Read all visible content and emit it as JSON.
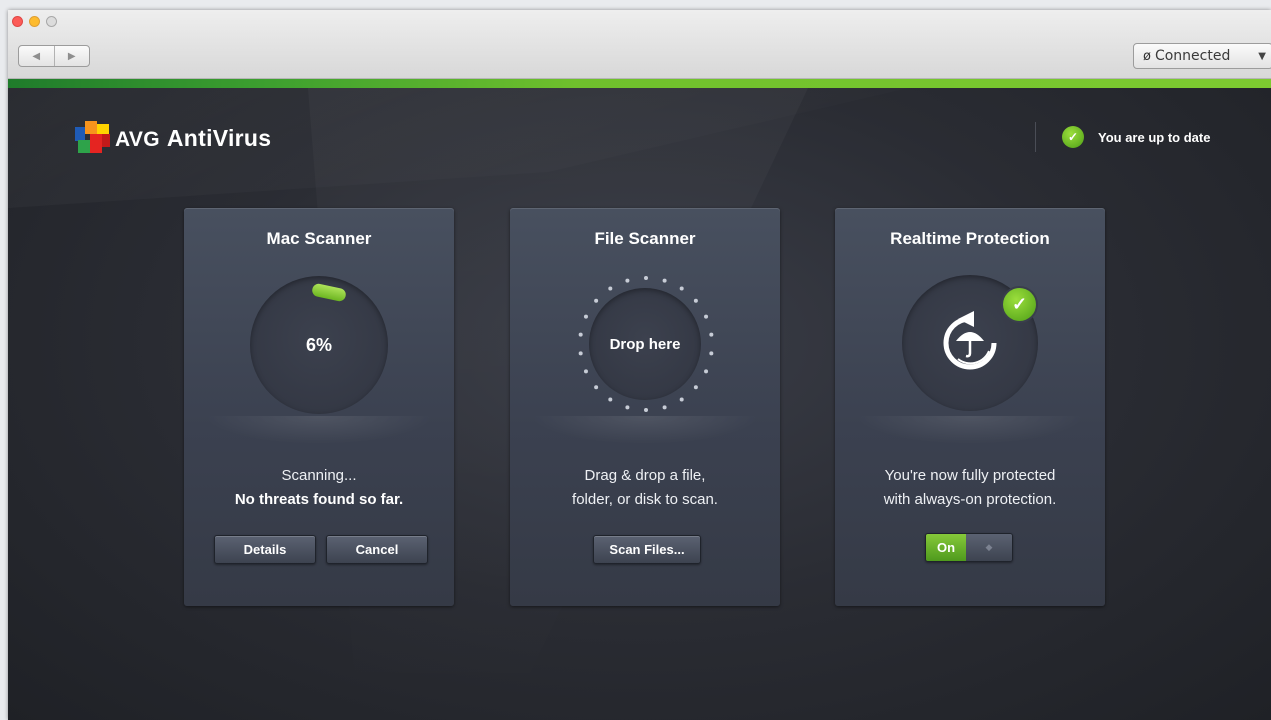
{
  "window": {
    "connection": {
      "label": "Connected"
    }
  },
  "header": {
    "logo": {
      "brand": "AVG",
      "product": "AntiVirus"
    },
    "status": {
      "text": "You are up to date"
    }
  },
  "cards": {
    "mac_scanner": {
      "title": "Mac Scanner",
      "progress": "6%",
      "progress_value": 0.06,
      "line1": "Scanning...",
      "line2": "No threats found so far.",
      "details_label": "Details",
      "cancel_label": "Cancel"
    },
    "file_scanner": {
      "title": "File Scanner",
      "drop_label": "Drop here",
      "line1": "Drag & drop a file,",
      "line2": "folder, or disk to scan.",
      "scan_label": "Scan Files..."
    },
    "realtime": {
      "title": "Realtime Protection",
      "line1": "You're now fully protected",
      "line2": "with always-on protection.",
      "toggle_label": "On"
    }
  },
  "colors": {
    "accent_green": "#6fc02c",
    "card_bg": "#434a58",
    "window_bg": "#26282e"
  }
}
